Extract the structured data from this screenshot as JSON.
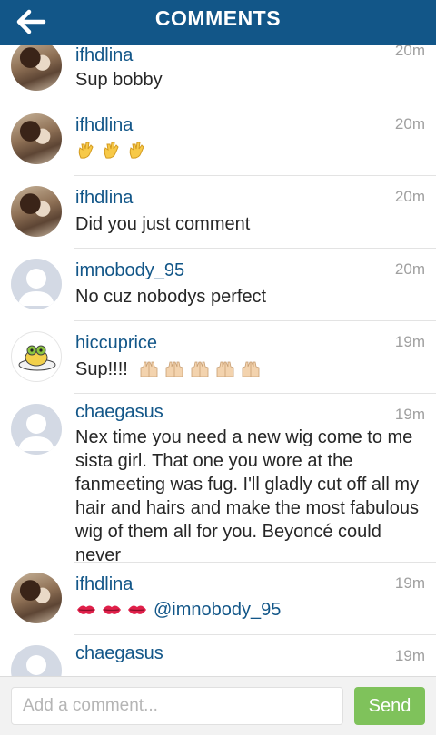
{
  "header": {
    "title": "COMMENTS",
    "back_icon": "arrow-left-icon"
  },
  "comments": [
    {
      "username": "ifhdlina",
      "time": "20m",
      "text": "Sup bobby",
      "avatar": "photo"
    },
    {
      "username": "ifhdlina",
      "time": "20m",
      "emoji": [
        "waving-hands-icon",
        "waving-hands-icon",
        "waving-hands-icon"
      ],
      "avatar": "photo"
    },
    {
      "username": "ifhdlina",
      "time": "20m",
      "text": "Did you just comment",
      "avatar": "photo"
    },
    {
      "username": "imnobody_95",
      "time": "20m",
      "text": "No cuz nobodys perfect",
      "avatar": "generic"
    },
    {
      "username": "hiccuprice",
      "time": "19m",
      "text": "Sup!!!!",
      "emoji": [
        "raised-hands-icon",
        "raised-hands-icon",
        "raised-hands-icon",
        "raised-hands-icon",
        "raised-hands-icon"
      ],
      "avatar": "frog"
    },
    {
      "username": "chaegasus",
      "time": "19m",
      "text": "Nex time you need a new wig come to me sista girl. That one you wore at the fanmeeting was fug. I'll gladly cut off all my hair and hairs and make the most fabulous wig of them all for you. Beyoncé could never",
      "avatar": "generic"
    },
    {
      "username": "ifhdlina",
      "time": "19m",
      "text": "@imnobody_95",
      "emoji": [
        "kiss-mark-icon",
        "kiss-mark-icon",
        "kiss-mark-icon"
      ],
      "avatar": "photo"
    },
    {
      "username": "chaegasus",
      "time": "19m",
      "avatar": "generic"
    }
  ],
  "composer": {
    "placeholder": "Add a comment...",
    "send_label": "Send"
  },
  "colors": {
    "header": "#125688",
    "username": "#125688",
    "send": "#7fc25b",
    "time": "#a0a0a0"
  }
}
